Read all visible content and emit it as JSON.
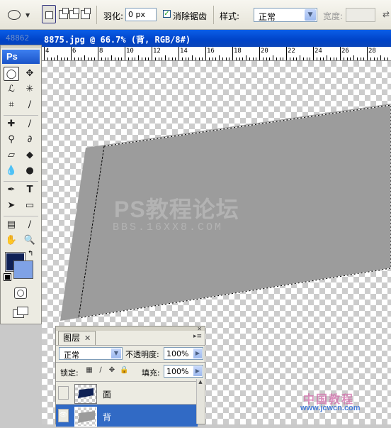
{
  "options_bar": {
    "feather_label": "羽化:",
    "feather_value": "0 px",
    "antialias_label": "消除锯齿",
    "antialias_checked": true,
    "style_label": "样式:",
    "style_value": "正常",
    "width_label": "宽度:"
  },
  "document": {
    "title": "8875.jpg @ 66.7% (背, RGB/8#)",
    "title_ghost": "48862"
  },
  "ruler": {
    "labels": [
      "4",
      "6",
      "8",
      "10",
      "12",
      "14",
      "16",
      "18",
      "20",
      "22",
      "24",
      "26",
      "28"
    ]
  },
  "canvas": {
    "watermark_main": "PS教程论坛",
    "watermark_sub": "BBS.16XX8.COM",
    "shape_color": "#9c9c9c"
  },
  "toolbox": {
    "logo": "Ps",
    "foreground_color": "#0f2155",
    "background_color": "#7fa2e6"
  },
  "layers_panel": {
    "tab_label": "图层",
    "blend_mode": "正常",
    "opacity_label": "不透明度:",
    "opacity_value": "100%",
    "lock_label": "锁定:",
    "fill_label": "填充:",
    "fill_value": "100%",
    "layers": [
      {
        "name": "面",
        "visible": false,
        "selected": false
      },
      {
        "name": "背",
        "visible": true,
        "selected": true
      }
    ]
  },
  "site_watermark": "www.jcwcn.com",
  "site_watermark_top": "中国教程"
}
